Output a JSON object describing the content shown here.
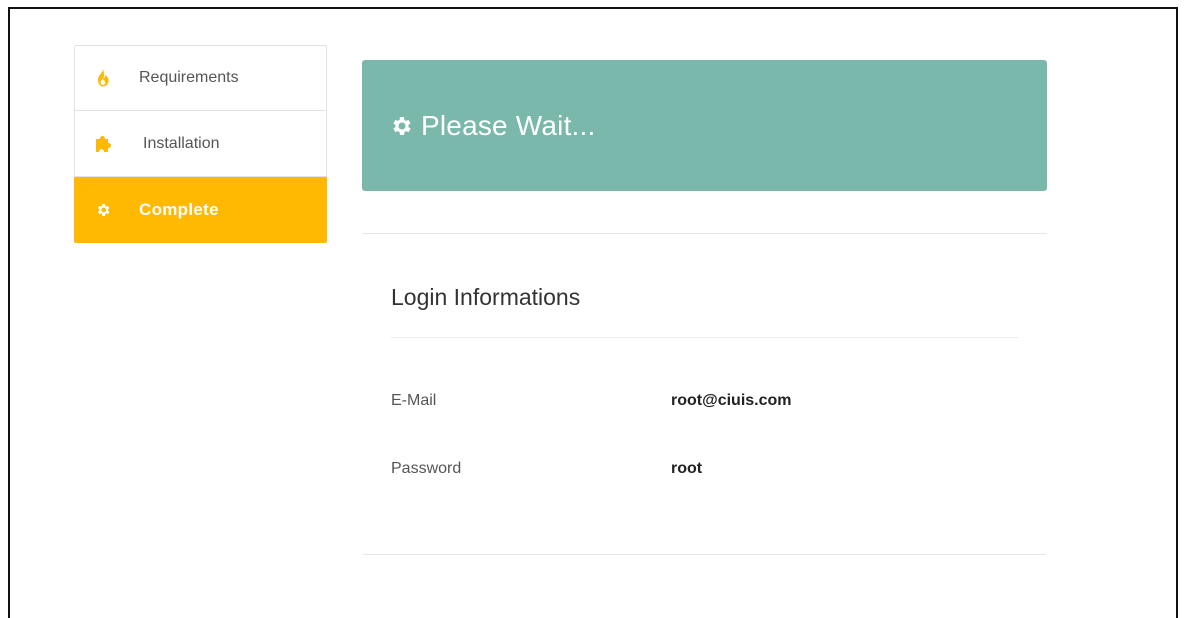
{
  "sidebar": {
    "items": [
      {
        "label": "Requirements",
        "icon": "fire-icon",
        "state": "default"
      },
      {
        "label": "Installation",
        "icon": "puzzle-icon",
        "state": "default"
      },
      {
        "label": "Complete",
        "icon": "gear-icon",
        "state": "active"
      }
    ]
  },
  "banner": {
    "title": "Please Wait...",
    "icon": "gear-icon",
    "color": "#7ab8ac"
  },
  "login": {
    "title": "Login Informations",
    "email_label": "E-Mail",
    "email_value": "root@ciuis.com",
    "password_label": "Password",
    "password_value": "root"
  },
  "colors": {
    "accent": "#ffb900",
    "banner": "#7ab8ac"
  }
}
